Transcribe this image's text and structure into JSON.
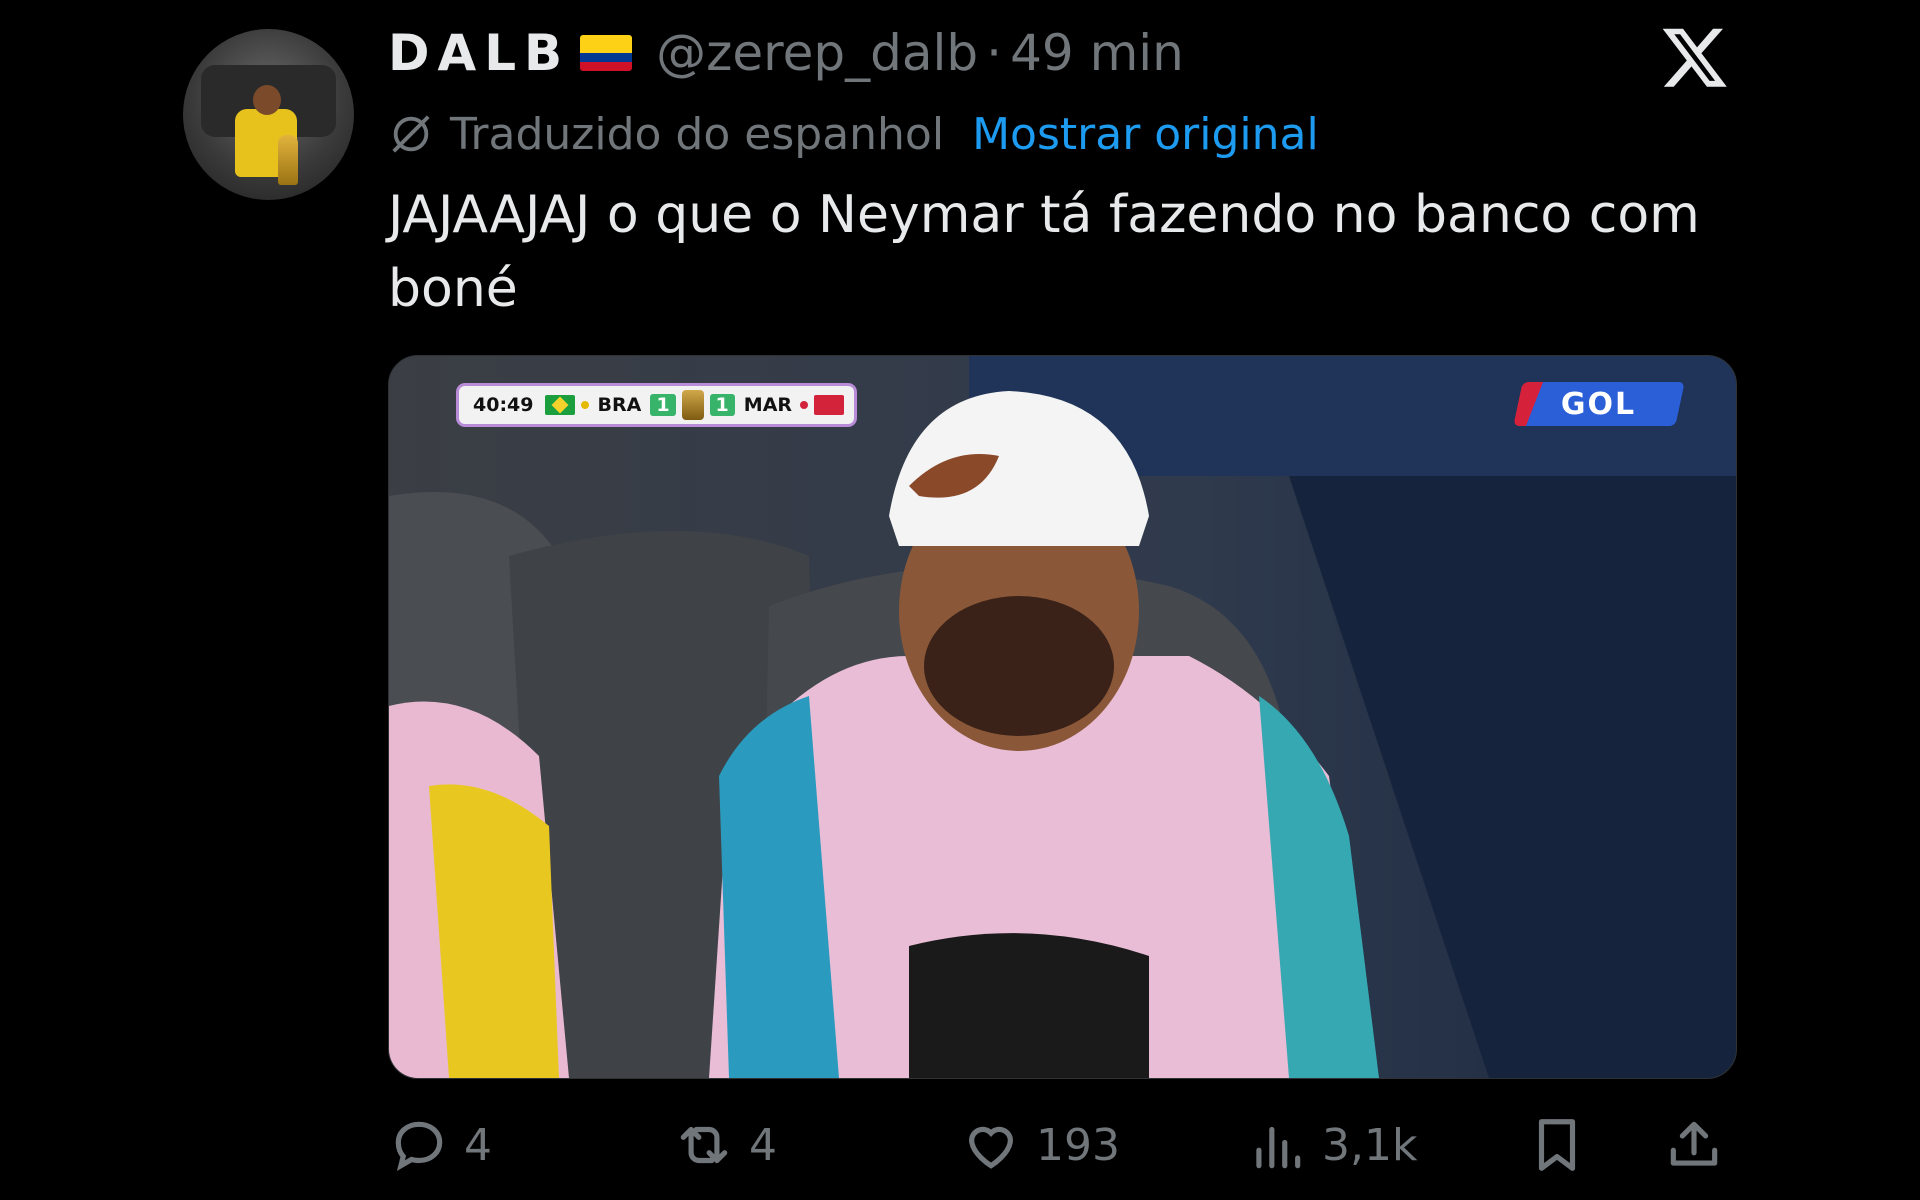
{
  "tweet": {
    "display_name": "DALB",
    "flag": "colombia-flag",
    "handle": "@zerep_dalb",
    "separator": "·",
    "time": "49 min",
    "translated_label": "Traduzido do espanhol",
    "show_original": "Mostrar original",
    "text": "JAJAAJAJ o que o Neymar tá fazendo no banco com boné"
  },
  "media": {
    "scorebug": {
      "clock": "40:49",
      "home_team": "BRA",
      "home_score": "1",
      "away_score": "1",
      "away_team": "MAR"
    },
    "broadcaster_logo": "GOL"
  },
  "actions": {
    "replies": "4",
    "reposts": "4",
    "likes": "193",
    "views": "3,1k"
  },
  "colors": {
    "background": "#000000",
    "text": "#e7e9ea",
    "muted": "#71767b",
    "link": "#1d9bf0"
  },
  "icons": [
    "x-logo-icon",
    "globe-slash-icon",
    "reply-icon",
    "repost-icon",
    "like-icon",
    "views-icon",
    "bookmark-icon",
    "share-icon"
  ]
}
